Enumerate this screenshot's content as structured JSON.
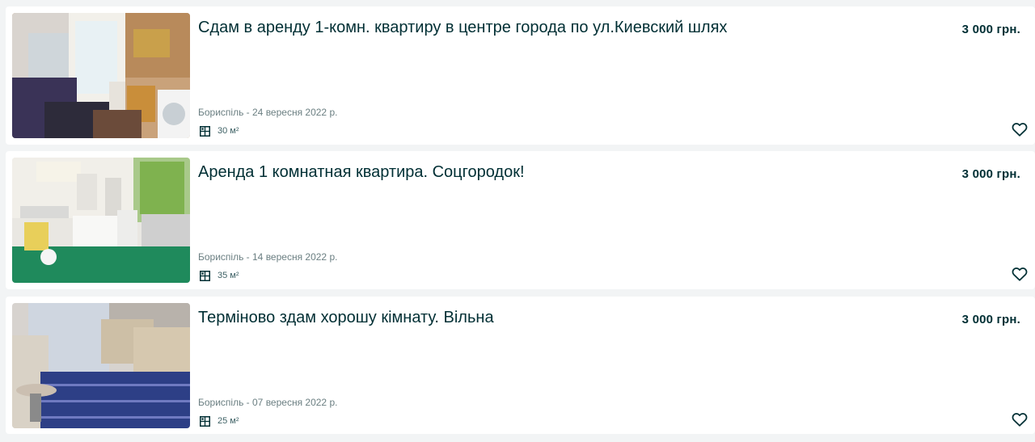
{
  "listings": [
    {
      "title": "Сдам в аренду 1-комн. квартиру в центре города по ул.Киевский шлях",
      "price": "3 000 грн.",
      "location_date": "Бориспіль - 24 вересня 2022 р.",
      "area": "30 м²",
      "image_alt": "kitchen with fridge, stove and washing machine"
    },
    {
      "title": "Аренда 1 комнатная квартира. Соцгородок!",
      "price": "3 000 грн.",
      "location_date": "Бориспіль - 14 вересня 2022 р.",
      "area": "35 м²",
      "image_alt": "kitchen with green floor and window"
    },
    {
      "title": "Терміново здам хорошу кімнату. Вільна",
      "price": "3 000 грн.",
      "location_date": "Бориспіль - 07 вересня 2022 р.",
      "area": "25 м²",
      "image_alt": "room with armchairs and blue carpet"
    }
  ],
  "icons": {
    "area": "floor-plan-icon",
    "favorite": "heart-outline-icon"
  },
  "colors": {
    "page_background": "#f2f4f5",
    "card_background": "#ffffff",
    "text_primary": "#002f34",
    "text_secondary": "#6b7f82"
  }
}
